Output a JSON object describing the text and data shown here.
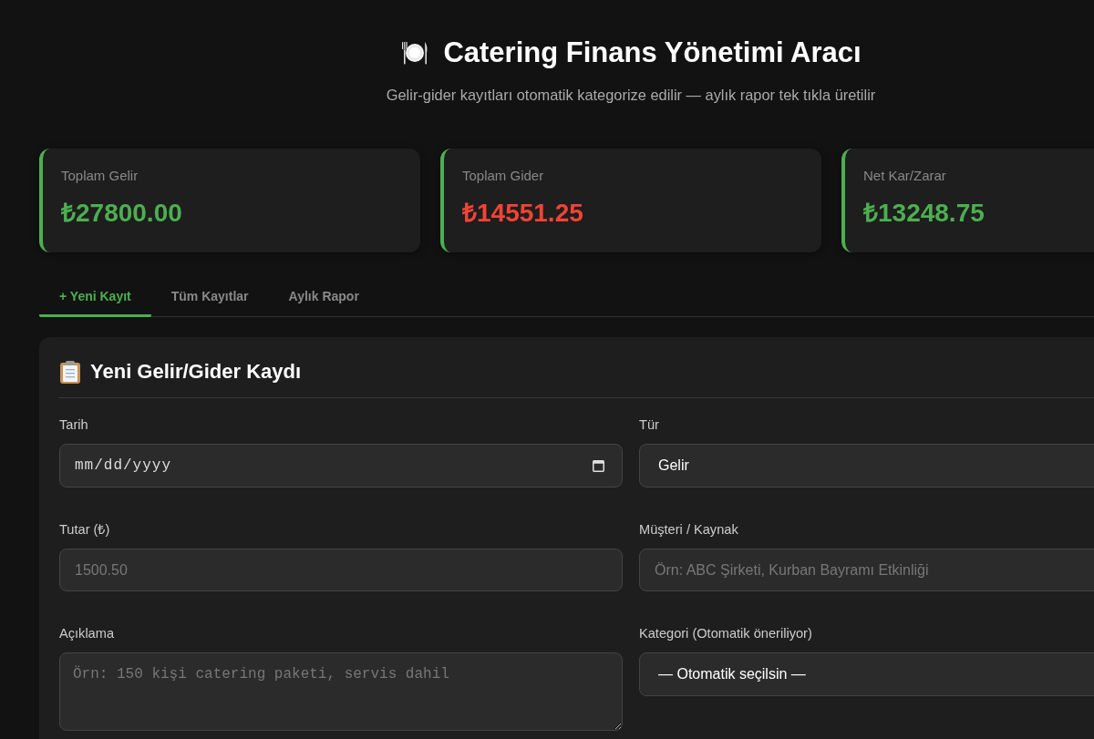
{
  "header": {
    "title": "Catering Finans Yönetimi Aracı",
    "subtitle": "Gelir-gider kayıtları otomatik kategorize edilir — aylık rapor tek tıkla üretilir"
  },
  "summary_cards": [
    {
      "label": "Toplam Gelir",
      "value": "₺27800.00",
      "color": "#4caf50"
    },
    {
      "label": "Toplam Gider",
      "value": "₺14551.25",
      "color": "#f44336"
    },
    {
      "label": "Net Kar/Zarar",
      "value": "₺13248.75",
      "color": "#4caf50"
    }
  ],
  "tabs": [
    {
      "label": "+ Yeni Kayıt",
      "selected": true
    },
    {
      "label": "Tüm Kayıtlar",
      "selected": false
    },
    {
      "label": "Aylık Rapor",
      "selected": false
    }
  ],
  "form": {
    "title": "Yeni Gelir/Gider Kaydı",
    "fields": [
      {
        "label": "Tarih",
        "kind": "date",
        "placeholder": "mm/dd/yyyy"
      },
      {
        "label": "Tür",
        "kind": "select",
        "value": "Gelir"
      },
      {
        "label": "Tutar (₺)",
        "kind": "text",
        "placeholder": "1500.50"
      },
      {
        "label": "Müşteri / Kaynak",
        "kind": "text",
        "placeholder": "Örn: ABC Şirketi, Kurban Bayramı Etkinliği"
      },
      {
        "label": "Açıklama",
        "kind": "textarea",
        "placeholder": "Örn: 150 kişi catering paketi, servis dahil"
      },
      {
        "label": "Kategori (Otomatik öneriliyor)",
        "kind": "select",
        "value": "— Otomatik seçilsin —"
      }
    ]
  }
}
